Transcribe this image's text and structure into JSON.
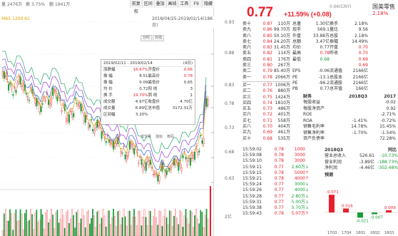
{
  "toolbar": {
    "volume_label": "量",
    "volume_value": "2476万",
    "turnover_label": "换",
    "turnover_value": "3.75%",
    "amount_label": "额",
    "amount_value": "1941万",
    "menu": [
      "前复权",
      "区间",
      "叠加",
      "画线",
      "工具",
      "F9",
      "隐藏"
    ]
  },
  "chart": {
    "ma_label": "MA5",
    "ma_value": "1200.61",
    "date_range": "2018/04/25-2019/02/14(186日)",
    "axis_labels": [
      "0.93",
      "0.88",
      "0.83",
      "0.78",
      "0.73",
      "0.68",
      "0.63"
    ],
    "low_label": "0.63",
    "vol_axis": "2亿",
    "tabs": [
      "分时",
      "日线"
    ],
    "sub_tabs": [
      "成交量",
      "指标",
      "筹码"
    ]
  },
  "tooltip": {
    "header": "2019/02/11 - 2019/02/14",
    "days": "(4日)",
    "rows": [
      {
        "k1": "涨跌幅",
        "v1": "16.67%",
        "k2": "开盘价",
        "v2": "0.66"
      },
      {
        "k1": "振  幅",
        "v1": "8.51",
        "k2": "最高价",
        "v2": "0.78"
      },
      {
        "k1": "振  幅",
        "v1": "0.09",
        "k2": "最低价",
        "v2": "0.65"
      },
      {
        "k1": "均  价",
        "v1": "0.72",
        "k2": "阳  线",
        "v2": "3"
      },
      {
        "k1": "换  手",
        "v1": "19.70%",
        "k2": "阴  线",
        "v2": "1"
      },
      {
        "k1": "成交额",
        "v1": "4.97亿",
        "k2": "收盘价",
        "v2": "4.70亿"
      },
      {
        "k1": "成交量",
        "v1": "6.89亿",
        "k2": "总市值",
        "v2": "3172.31万"
      },
      {
        "k1": "区间幅",
        "v1": "3.20%",
        "k2": "",
        "v2": ""
      }
    ]
  },
  "quote": {
    "price": "0.77",
    "change": "+11.59%",
    "change_abs": "(+0.08)",
    "currency": "0.66(CNY)",
    "name": "国美零售",
    "pct": "2.18%"
  },
  "orderbook": [
    {
      "label": "卖十",
      "price": "0.87",
      "vol": "110万"
    },
    {
      "label": "卖九",
      "price": "0.86",
      "vol": "99.70万"
    },
    {
      "label": "卖八",
      "price": "0.85",
      "vol": "50.10万"
    },
    {
      "label": "卖七",
      "price": "0.84",
      "vol": "24.20万"
    },
    {
      "label": "卖六",
      "price": "0.83",
      "vol": "31.45万"
    },
    {
      "label": "卖五",
      "price": "0.82",
      "vol": "114万"
    },
    {
      "label": "卖四",
      "price": "0.81",
      "vol": "176万"
    },
    {
      "label": "卖三",
      "price": "0.80",
      "vol": "267万"
    },
    {
      "label": "卖二",
      "price": "0.79",
      "vol": "85.40万"
    },
    {
      "label": "卖一",
      "price": "0.78",
      "vol": "2066万"
    },
    {
      "label": "买一",
      "price": "0.77",
      "vol": "1006万"
    },
    {
      "label": "买二",
      "price": "0.76",
      "vol": "880万"
    },
    {
      "label": "买三",
      "price": "0.75",
      "vol": "1424万"
    },
    {
      "label": "买四",
      "price": "0.74",
      "vol": "1810万"
    },
    {
      "label": "买五",
      "price": "0.73",
      "vol": "486万"
    },
    {
      "label": "买六",
      "price": "0.72",
      "vol": "401万"
    },
    {
      "label": "买七",
      "price": "0.71",
      "vol": "558万"
    },
    {
      "label": "买八",
      "price": "0.70",
      "vol": "404万"
    },
    {
      "label": "买九",
      "price": "0.69",
      "vol": "461万"
    },
    {
      "label": "买十",
      "price": "0.68",
      "vol": "535万"
    }
  ],
  "stats": [
    {
      "k1": "总量",
      "v1": "1.30亿",
      "k2": "换手",
      "v2": "2.18%"
    },
    {
      "k1": "现手",
      "v1": "569.1",
      "k2": "量比",
      "v2": "9.56"
    },
    {
      "k1": "外盘",
      "v1": "33.88万",
      "k2": "总股",
      "v2": "2.18%"
    },
    {
      "k1": "总额",
      "v1": "3.47亿",
      "k2": "振幅",
      "v2": "14.49%"
    },
    {
      "k1": "均价",
      "v1": "0.77",
      "k2": "开盘",
      "v2": "0.70"
    },
    {
      "k1": "最高",
      "v1": "0.78",
      "k2": "昨收",
      "v2": "0.70"
    },
    {
      "k1": "最低",
      "v1": "0.68",
      "k2": "",
      "v2": "0.69"
    },
    {
      "k1": "",
      "v1": "",
      "k2": "",
      "v2": "0.69"
    },
    {
      "k1": "EPS",
      "v1": "-0.06",
      "k2": "流通值",
      "v2": "2166亿"
    },
    {
      "k1": "PE",
      "v1": "-13.1",
      "k2": "总股本",
      "v2": "2166亿"
    },
    {
      "k1": "PE",
      "v1": "-96.2",
      "k2": "流通股",
      "v2": "2166亿"
    },
    {
      "k1": "PB",
      "v1": "0.77",
      "k2": "总市值",
      "v2": "166亿"
    }
  ],
  "financials": {
    "title": "财务",
    "col1": "2018Q3",
    "col2": "2017",
    "rows": [
      {
        "k": "每股收益",
        "v1": "",
        "v2": "-0.02"
      },
      {
        "k": "每股净资产",
        "v1": "",
        "v2": "0.92"
      },
      {
        "k": "ROE",
        "v1": "",
        "v2": "-2.71%"
      },
      {
        "k": "ROA",
        "v1": "-1.41%",
        "v2": "-0.72%"
      },
      {
        "k": "销售毛利率",
        "v1": "14.78%",
        "v2": "15.45%"
      },
      {
        "k": "销售净利率",
        "v1": "-1.70%",
        "v2": "-1.54%"
      },
      {
        "k": "资产负债率",
        "v1": "",
        "v2": "72.28%"
      }
    ]
  },
  "trades": [
    {
      "time": "15:59:02",
      "price": "0.78",
      "vol": "1000",
      "dir": ""
    },
    {
      "time": "15:59:08",
      "price": "0.78",
      "vol": "3000",
      "dir": ""
    },
    {
      "time": "15:59:10",
      "price": "0.78",
      "vol": "3000",
      "dir": ""
    },
    {
      "time": "15:59:11",
      "price": "0.77",
      "vol": "2.60万",
      "dir": "↓"
    },
    {
      "time": "15:59:15",
      "price": "0.78",
      "vol": "5000",
      "dir": "↑"
    },
    {
      "time": "15:59:21",
      "price": "0.78",
      "vol": "4000",
      "dir": "↑"
    },
    {
      "time": "15:59:24",
      "price": "0.77",
      "vol": "3000",
      "dir": "↓"
    },
    {
      "time": "15:59:26",
      "price": "0.77",
      "vol": "4000",
      "dir": "↓"
    },
    {
      "time": "15:59:28",
      "price": "0.77",
      "vol": "2.80万",
      "dir": "↓"
    },
    {
      "time": "15:59:31",
      "price": "0.77",
      "vol": "5.00万",
      "dir": "↓"
    },
    {
      "time": "15:59:38",
      "price": "0.77",
      "vol": "5.70万",
      "dir": "↓"
    },
    {
      "time": "15:59:43",
      "price": "0.78",
      "vol": "5.07万",
      "dir": "↑"
    }
  ],
  "revenue": {
    "title": "2018Q3",
    "right": "同比",
    "rows": [
      {
        "k": "营业总收入",
        "v1": "526.61",
        "v2": "-10.73%"
      },
      {
        "k": "营业利润",
        "v1": "-3.89亿",
        "v2": "-188.73%"
      },
      {
        "k": "净利润",
        "v1": "-4.46亿",
        "v2": "-302.48%"
      }
    ],
    "forecast": "预测",
    "bars": [
      {
        "q": "17Q3",
        "val": 0.071,
        "label": "0.071"
      },
      {
        "q": "17Q4",
        "val": 0.016,
        "label": "0.016"
      },
      {
        "q": "18Q1",
        "val": -0.021,
        "label": "-0.021"
      },
      {
        "q": "18Q2",
        "val": -0.007,
        "label": "-0.007"
      },
      {
        "q": "18Q3",
        "val": 0.009,
        "label": "0.009"
      }
    ]
  },
  "colors": {
    "up": "#e8202c",
    "down": "#1a9c38",
    "ma1": "#e0a000",
    "ma2": "#2a67c5",
    "ma3": "#9a3fd0",
    "ma4": "#29a86b"
  }
}
